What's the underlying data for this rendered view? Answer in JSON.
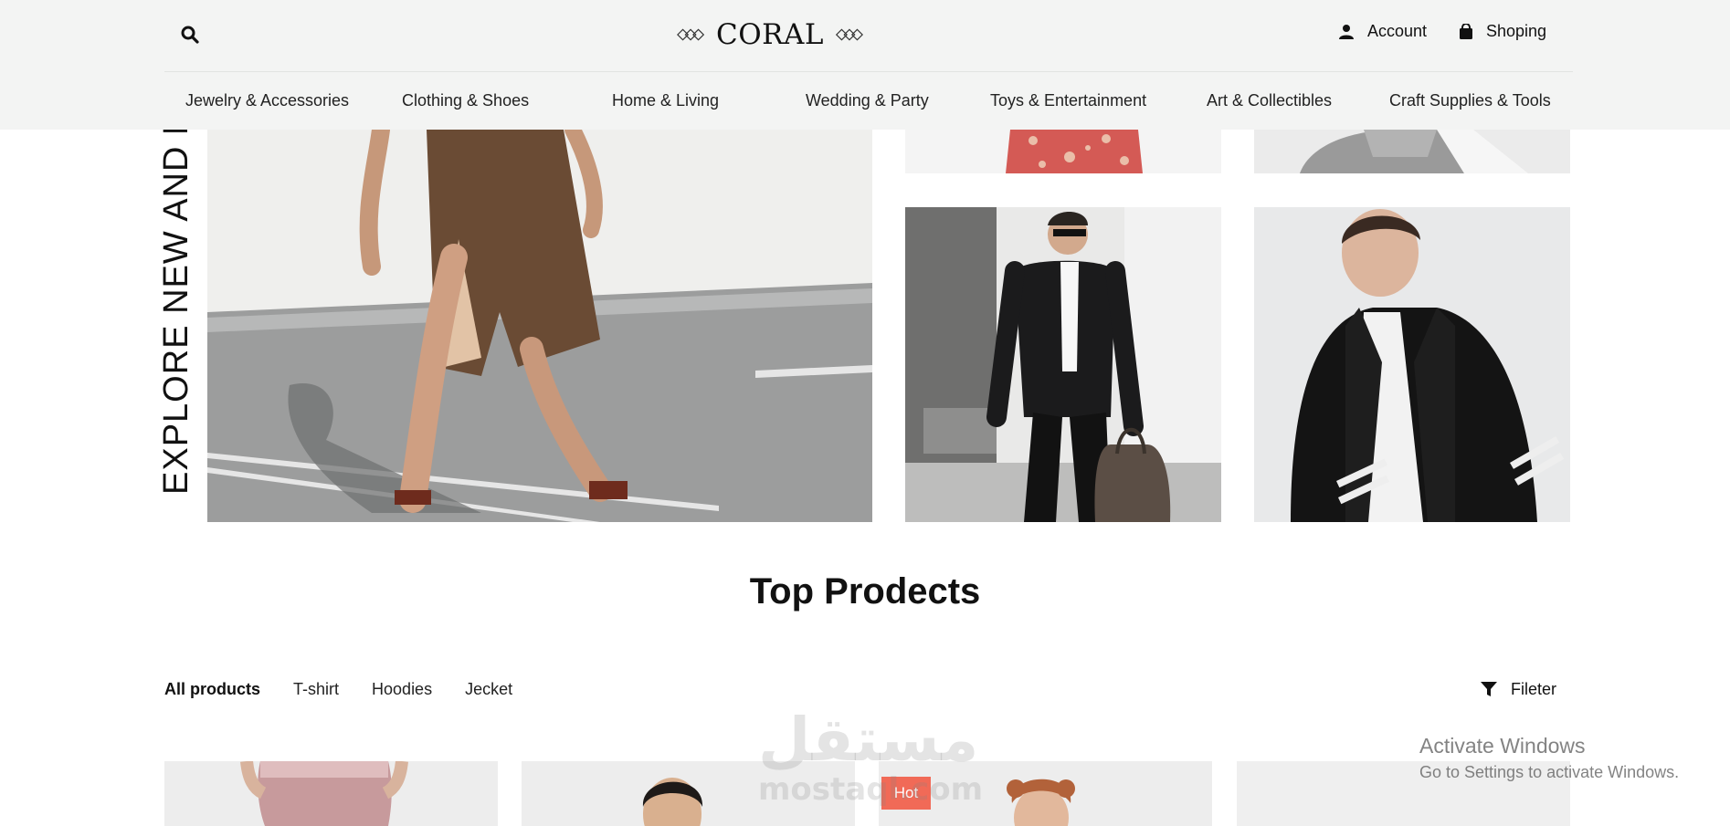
{
  "header": {
    "brand": "CORAL",
    "account_label": "Account",
    "shop_label": "Shoping",
    "nav": [
      "Jewelry & Accessories",
      "Clothing & Shoes",
      "Home & Living",
      "Wedding & Party",
      "Toys & Entertainment",
      "Art & Collectibles",
      "Craft Supplies & Tools"
    ]
  },
  "hero": {
    "vertical_text": "EXPLORE NEW AND POPULAR STYLES"
  },
  "products": {
    "title": "Top Prodects",
    "filters": [
      "All products",
      "T-shirt",
      "Hoodies",
      "Jecket"
    ],
    "filter_button": "Fileter",
    "badge": "Hot"
  },
  "overlay": {
    "watermark_ar": "مستقل",
    "watermark_en": "mostaql.com",
    "activation_title": "Activate Windows",
    "activation_subtitle": "Go to Settings to activate Windows."
  },
  "icons": {
    "search": "search-icon",
    "account": "user-icon",
    "shop": "shopping-bag-icon",
    "filter": "funnel-icon"
  },
  "colors": {
    "header_bg": "#f3f4f3",
    "badge": "#f16a57"
  }
}
